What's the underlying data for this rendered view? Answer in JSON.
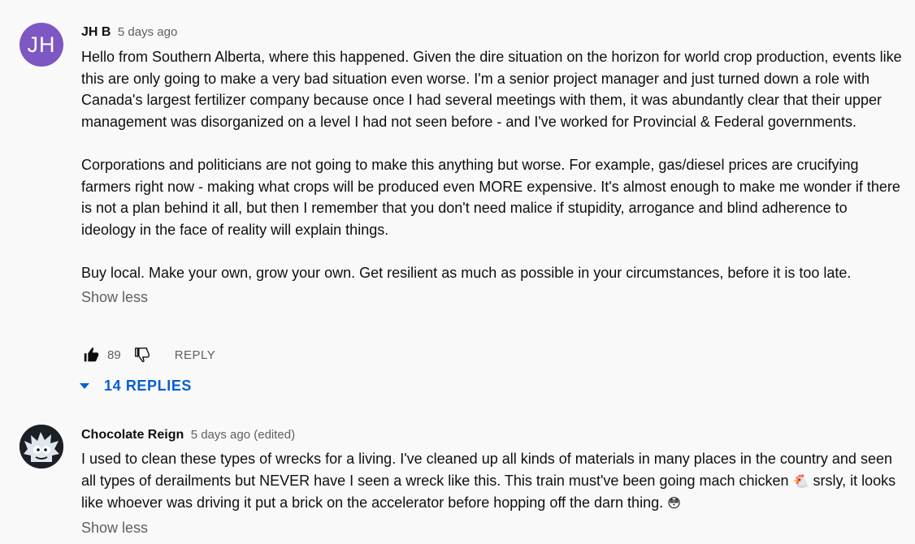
{
  "comments": [
    {
      "avatar_initials": "JH",
      "author": "JH B",
      "time": "5 days ago",
      "paragraphs": [
        "Hello from Southern Alberta, where this happened. Given the dire situation on the horizon for world crop production, events like this are only going to make a very bad situation even worse. I'm a senior project manager and just turned down a role with Canada's largest fertilizer company because once I had several meetings with them, it was abundantly clear that their upper management was disorganized on a level I had not seen before - and I've worked for Provincial & Federal governments.",
        "Corporations and politicians are not going to make this anything but worse. For example, gas/diesel prices are crucifying farmers right now - making what crops will be produced even MORE expensive. It's almost enough to make me wonder if there is not a plan behind it all, but then I remember that you don't need malice if stupidity, arrogance and blind adherence to ideology in the face of reality will explain things.",
        "Buy local. Make your own, grow your own. Get resilient as much as possible in your circumstances, before it is too late."
      ],
      "show_less": "Show less",
      "likes": "89",
      "reply_label": "REPLY",
      "replies_label": "14 REPLIES"
    },
    {
      "author": "Chocolate Reign",
      "time": "5 days ago (edited)",
      "text_1": "I used to clean these types of wrecks for a living. I've cleaned up all kinds of materials in many places in the country and seen all types of derailments but NEVER have I seen a wreck like this. This train must've been going mach chicken",
      "emoji_1": "🐔",
      "text_2": "srsly, it looks like whoever was driving it put a brick on the accelerator before hopping off the darn thing.",
      "emoji_2": "😳",
      "show_less": "Show less"
    }
  ],
  "colors": {
    "background": "#f9f9f9",
    "avatar_purple": "#7e57c2",
    "link_blue": "#065fd4",
    "secondary_text": "#606060"
  },
  "icons": [
    "thumbs-up-filled-icon",
    "thumbs-down-outline-icon",
    "caret-down-icon"
  ]
}
